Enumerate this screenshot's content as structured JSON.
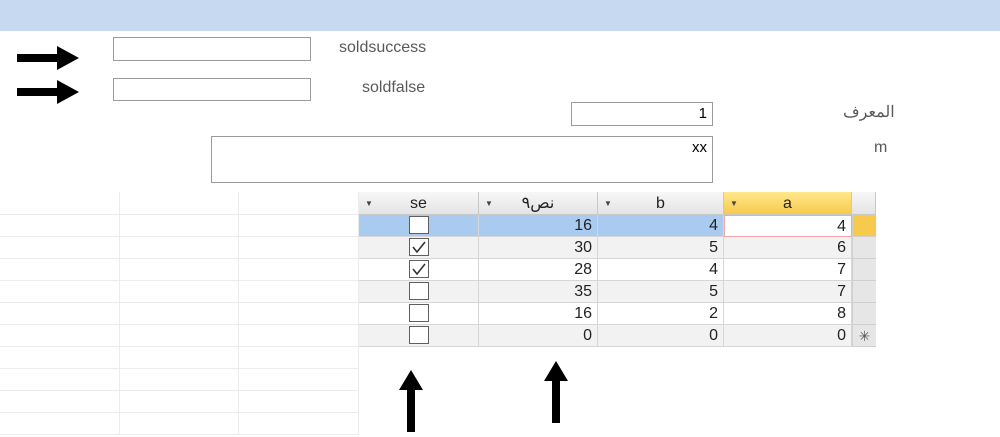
{
  "form": {
    "soldsuccess_label": "soldsuccess",
    "soldsuccess_value": "",
    "soldfalse_label": "soldfalse",
    "soldfalse_value": "",
    "id_label": "المعرف",
    "id_value": "1",
    "m_label": "m",
    "m_value": "xx"
  },
  "grid": {
    "columns": [
      {
        "key": "se",
        "label": "se"
      },
      {
        "key": "nas9",
        "label": "نص٩"
      },
      {
        "key": "b",
        "label": "b"
      },
      {
        "key": "a",
        "label": "a"
      }
    ],
    "rows": [
      {
        "se": false,
        "nas9": "16",
        "b": "4",
        "a": "4"
      },
      {
        "se": true,
        "nas9": "30",
        "b": "5",
        "a": "6"
      },
      {
        "se": true,
        "nas9": "28",
        "b": "4",
        "a": "7"
      },
      {
        "se": false,
        "nas9": "35",
        "b": "5",
        "a": "7"
      },
      {
        "se": false,
        "nas9": "16",
        "b": "2",
        "a": "8"
      },
      {
        "se": false,
        "nas9": "0",
        "b": "0",
        "a": "0"
      }
    ],
    "new_record_marker": "✳",
    "active_column": "a",
    "selected_row": 1
  },
  "colors": {
    "title_bar": "#c6d9f1",
    "selected_row": "#a9cbef",
    "active_header": "#f7c94d"
  },
  "icons": [
    "arrow-right-icon",
    "arrow-right-icon",
    "arrow-up-icon",
    "arrow-up-icon",
    "dropdown-icon",
    "check-icon",
    "new-record-icon"
  ]
}
